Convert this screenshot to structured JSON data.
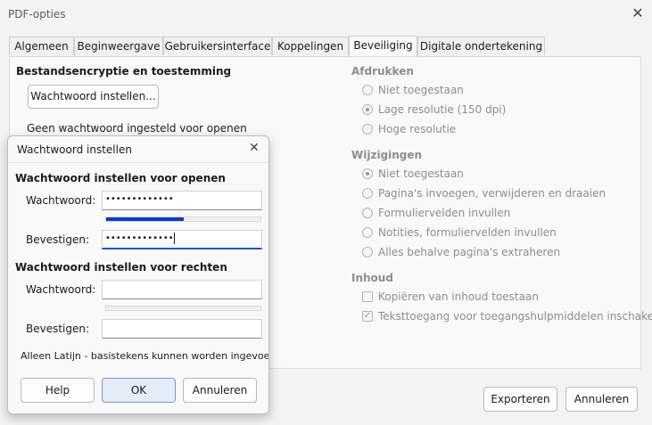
{
  "window": {
    "title": "PDF-opties",
    "close_glyph": "✕"
  },
  "tabs": [
    {
      "label": "Algemeen"
    },
    {
      "label": "Beginweergave"
    },
    {
      "label": "Gebruikersinterface"
    },
    {
      "label": "Koppelingen"
    },
    {
      "label": "Beveiliging",
      "active": true
    },
    {
      "label": "Digitale ondertekening"
    }
  ],
  "security": {
    "encryption_title": "Bestandsencryptie en toestemming",
    "set_password_button": "Wachtwoord instellen...",
    "no_password_text": "Geen wachtwoord ingesteld voor openen"
  },
  "printing": {
    "title": "Afdrukken",
    "options": [
      {
        "label": "Niet toegestaan",
        "selected": false
      },
      {
        "label": "Lage resolutie (150 dpi)",
        "selected": true
      },
      {
        "label": "Hoge resolutie",
        "selected": false
      }
    ]
  },
  "changes": {
    "title": "Wijzigingen",
    "options": [
      {
        "label": "Niet toegestaan",
        "selected": true
      },
      {
        "label": "Pagina's invoegen, verwijderen en draaien",
        "selected": false
      },
      {
        "label": "Formuliervelden invullen",
        "selected": false
      },
      {
        "label": "Notities, formuliervelden invullen",
        "selected": false
      },
      {
        "label": "Alles behalve pagina's extraheren",
        "selected": false
      }
    ]
  },
  "content": {
    "title": "Inhoud",
    "options": [
      {
        "label": "Kopiëren van inhoud toestaan",
        "checked": false
      },
      {
        "label": "Teksttoegang voor toegangshulpmiddelen inschakelen",
        "checked": true
      }
    ]
  },
  "footer": {
    "export_label": "Exporteren",
    "cancel_label": "Annuleren"
  },
  "dialog": {
    "title": "Wachtwoord instellen",
    "close_glyph": "✕",
    "open_section": {
      "title": "Wachtwoord instellen voor openen",
      "password_label": "Wachtwoord:",
      "password_value": "•••••••••••••",
      "strength": 0.5,
      "confirm_label": "Bevestigen:",
      "confirm_value": "•••••••••••••"
    },
    "rights_section": {
      "title": "Wachtwoord instellen voor rechten",
      "password_label": "Wachtwoord:",
      "password_value": "",
      "strength": 0,
      "confirm_label": "Bevestigen:",
      "confirm_value": ""
    },
    "latin_note": "Alleen Latijn - basistekens kunnen worden ingevoerd",
    "help_label": "Help",
    "ok_label": "OK",
    "cancel_label": "Annuleren"
  }
}
